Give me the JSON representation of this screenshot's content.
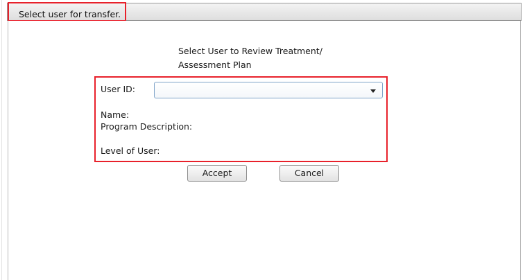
{
  "window": {
    "title": "Select user for transfer."
  },
  "dialog": {
    "heading": "Select User to Review Treatment/\nAssessment Plan",
    "fields": {
      "user_id_label": "User ID:",
      "user_id_value": "",
      "name_label": "Name:",
      "program_description_label": "Program Description:",
      "level_of_user_label": "Level of User:"
    },
    "buttons": {
      "accept": "Accept",
      "cancel": "Cancel"
    }
  },
  "colors": {
    "highlight": "#e8212b",
    "select_border": "#7da2c8"
  }
}
